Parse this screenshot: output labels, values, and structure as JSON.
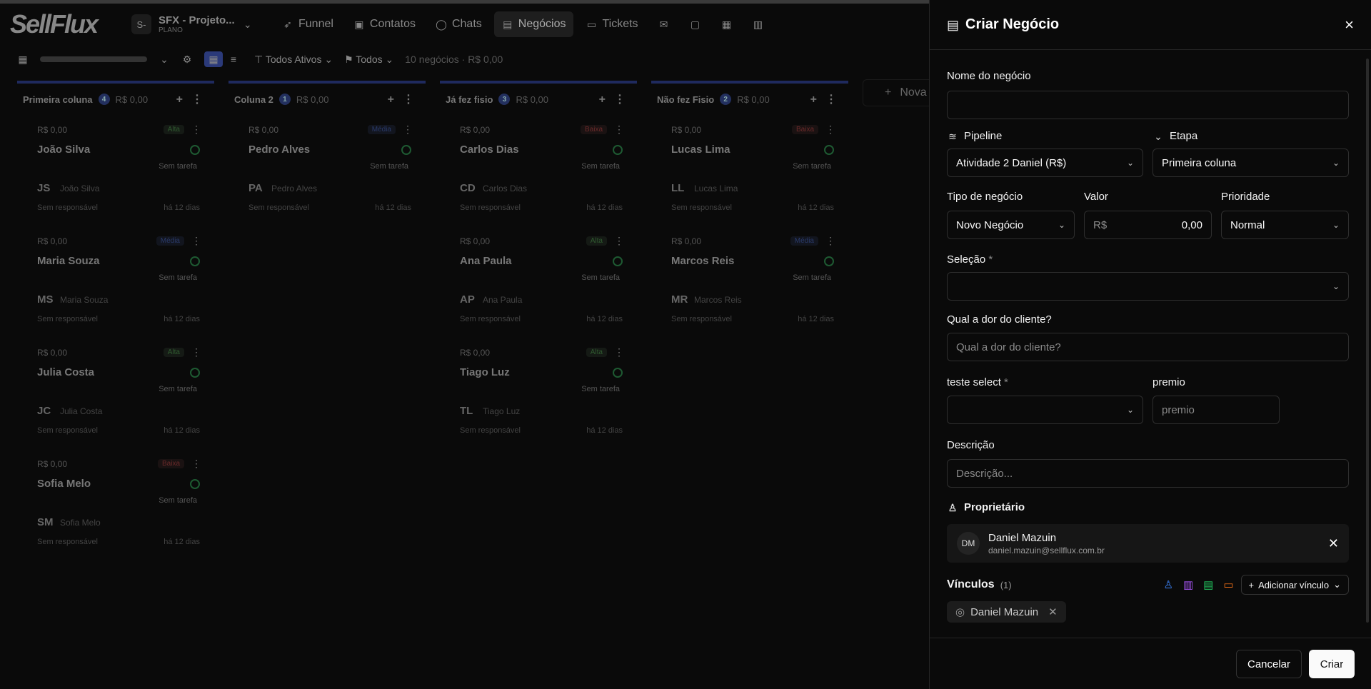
{
  "app": {
    "logo": "SellFlux"
  },
  "workspace": {
    "badge": "S-",
    "name": "SFX - Projeto...",
    "plan": "PLANO"
  },
  "nav": [
    {
      "label": "Funnel",
      "icon": "rocket-icon"
    },
    {
      "label": "Contatos",
      "icon": "contacts-icon"
    },
    {
      "label": "Chats",
      "icon": "chat-icon"
    },
    {
      "label": "Negócios",
      "icon": "briefcase-icon"
    },
    {
      "label": "Tickets",
      "icon": "ticket-icon"
    }
  ],
  "toolbar": {
    "filter_active": "Todos Ativos",
    "filter_all": "Todos",
    "count": "10 negócios · R$ 0,00",
    "new_column": "Nova"
  },
  "columns": [
    {
      "title": "Primeira coluna",
      "count": "4",
      "value": "R$ 0,00",
      "cards": [
        {
          "value": "R$ 0,00",
          "tag": "Alta",
          "tag_color": "green",
          "name": "João Silva",
          "task": "Sem tarefa",
          "initials": "JS",
          "person": "João Silva",
          "resp": "Sem responsável",
          "days": "há 12 dias"
        },
        {
          "value": "R$ 0,00",
          "tag": "Média",
          "tag_color": "blue",
          "name": "Maria Souza",
          "task": "Sem tarefa",
          "initials": "MS",
          "person": "Maria Souza",
          "resp": "Sem responsável",
          "days": "há 12 dias"
        },
        {
          "value": "R$ 0,00",
          "tag": "Alta",
          "tag_color": "green",
          "name": "Julia Costa",
          "task": "Sem tarefa",
          "initials": "JC",
          "person": "Julia Costa",
          "resp": "Sem responsável",
          "days": "há 12 dias"
        },
        {
          "value": "R$ 0,00",
          "tag": "Baixa",
          "tag_color": "red",
          "name": "Sofia Melo",
          "task": "Sem tarefa",
          "initials": "SM",
          "person": "Sofia Melo",
          "resp": "Sem responsável",
          "days": "há 12 dias"
        }
      ]
    },
    {
      "title": "Coluna 2",
      "count": "1",
      "value": "R$ 0,00",
      "cards": [
        {
          "value": "R$ 0,00",
          "tag": "Média",
          "tag_color": "blue",
          "name": "Pedro Alves",
          "task": "Sem tarefa",
          "initials": "PA",
          "person": "Pedro Alves",
          "resp": "Sem responsável",
          "days": "há 12 dias"
        }
      ]
    },
    {
      "title": "Já fez fisio",
      "count": "3",
      "value": "R$ 0,00",
      "cards": [
        {
          "value": "R$ 0,00",
          "tag": "Baixa",
          "tag_color": "red",
          "name": "Carlos Dias",
          "task": "Sem tarefa",
          "initials": "CD",
          "person": "Carlos Dias",
          "resp": "Sem responsável",
          "days": "há 12 dias"
        },
        {
          "value": "R$ 0,00",
          "tag": "Alta",
          "tag_color": "green",
          "name": "Ana Paula",
          "task": "Sem tarefa",
          "initials": "AP",
          "person": "Ana Paula",
          "resp": "Sem responsável",
          "days": "há 12 dias"
        },
        {
          "value": "R$ 0,00",
          "tag": "Alta",
          "tag_color": "green",
          "name": "Tiago Luz",
          "task": "Sem tarefa",
          "initials": "TL",
          "person": "Tiago Luz",
          "resp": "Sem responsável",
          "days": "há 12 dias"
        }
      ]
    },
    {
      "title": "Não fez Fisio",
      "count": "2",
      "value": "R$ 0,00",
      "cards": [
        {
          "value": "R$ 0,00",
          "tag": "Baixa",
          "tag_color": "red",
          "name": "Lucas Lima",
          "task": "Sem tarefa",
          "initials": "LL",
          "person": "Lucas Lima",
          "resp": "Sem responsável",
          "days": "há 12 dias"
        },
        {
          "value": "R$ 0,00",
          "tag": "Média",
          "tag_color": "blue",
          "name": "Marcos Reis",
          "task": "Sem tarefa",
          "initials": "MR",
          "person": "Marcos Reis",
          "resp": "Sem responsável",
          "days": "há 12 dias"
        }
      ]
    }
  ],
  "drawer": {
    "title": "Criar Negócio",
    "name_label": "Nome do negócio",
    "name_value": "",
    "pipeline_label": "Pipeline",
    "pipeline_value": "Atividade 2 Daniel (R$)",
    "stage_label": "Etapa",
    "stage_value": "Primeira coluna",
    "type_label": "Tipo de negócio",
    "type_value": "Novo Negócio",
    "value_label": "Valor",
    "value_prefix": "R$",
    "value_value": "0,00",
    "priority_label": "Prioridade",
    "priority_value": "Normal",
    "selection_label": "Seleção",
    "pain_label": "Qual a dor do cliente?",
    "pain_placeholder": "Qual a dor do cliente?",
    "test_label": "teste select",
    "premio_label": "premio",
    "premio_placeholder": "premio",
    "desc_label": "Descrição",
    "desc_placeholder": "Descrição...",
    "owner_label": "Proprietário",
    "owner_initials": "DM",
    "owner_name": "Daniel Mazuin",
    "owner_email": "daniel.mazuin@sellflux.com.br",
    "links_label": "Vínculos",
    "links_count": "(1)",
    "add_link": "Adicionar vínculo",
    "chip_name": "Daniel Mazuin",
    "cancel": "Cancelar",
    "create": "Criar",
    "required_mark": "*"
  },
  "colors": {
    "accent_blue": "#2b3a7a",
    "drawer_bg": "#0a0a0a",
    "primary_button": "#fafafa"
  }
}
